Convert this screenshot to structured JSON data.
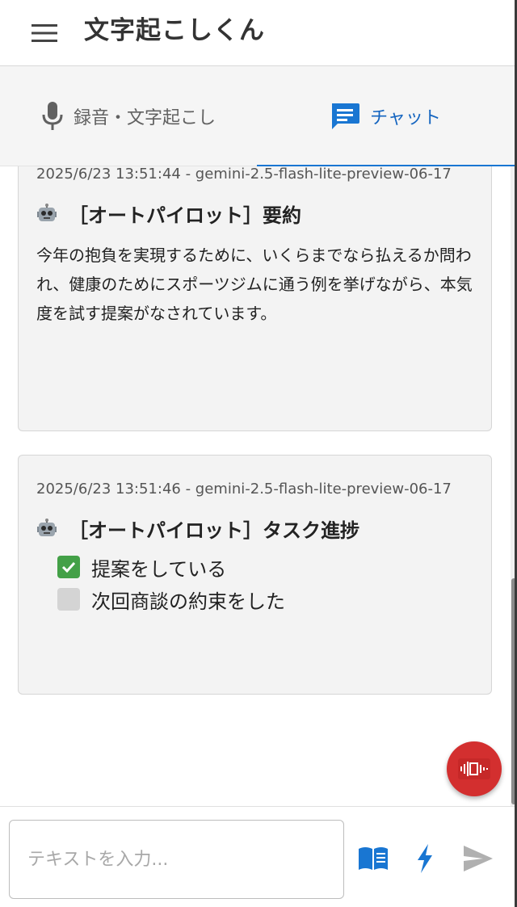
{
  "header": {
    "title": "文字起こしくん"
  },
  "tabs": [
    {
      "label": "録音・文字起こし",
      "icon": "microphone-icon",
      "active": false
    },
    {
      "label": "チャット",
      "icon": "chat-icon",
      "active": true
    }
  ],
  "messages": [
    {
      "meta": "2025/6/23 13:51:44 - gemini-2.5-flash-lite-preview-06-17",
      "title": "［オートパイロット］要約",
      "body": "今年の抱負を実現するために、いくらまでなら払えるか問われ、健康のためにスポーツジムに通う例を挙げながら、本気度を試す提案がなされています。"
    },
    {
      "meta": "2025/6/23 13:51:46 - gemini-2.5-flash-lite-preview-06-17",
      "title": "［オートパイロット］タスク進捗",
      "tasks": [
        {
          "label": "提案をしている",
          "done": true
        },
        {
          "label": "次回商談の約束をした",
          "done": false
        }
      ]
    }
  ],
  "input": {
    "placeholder": "テキストを入力..."
  },
  "colors": {
    "accent": "#1976d2",
    "fab": "#d32f2f",
    "done": "#43a047"
  }
}
